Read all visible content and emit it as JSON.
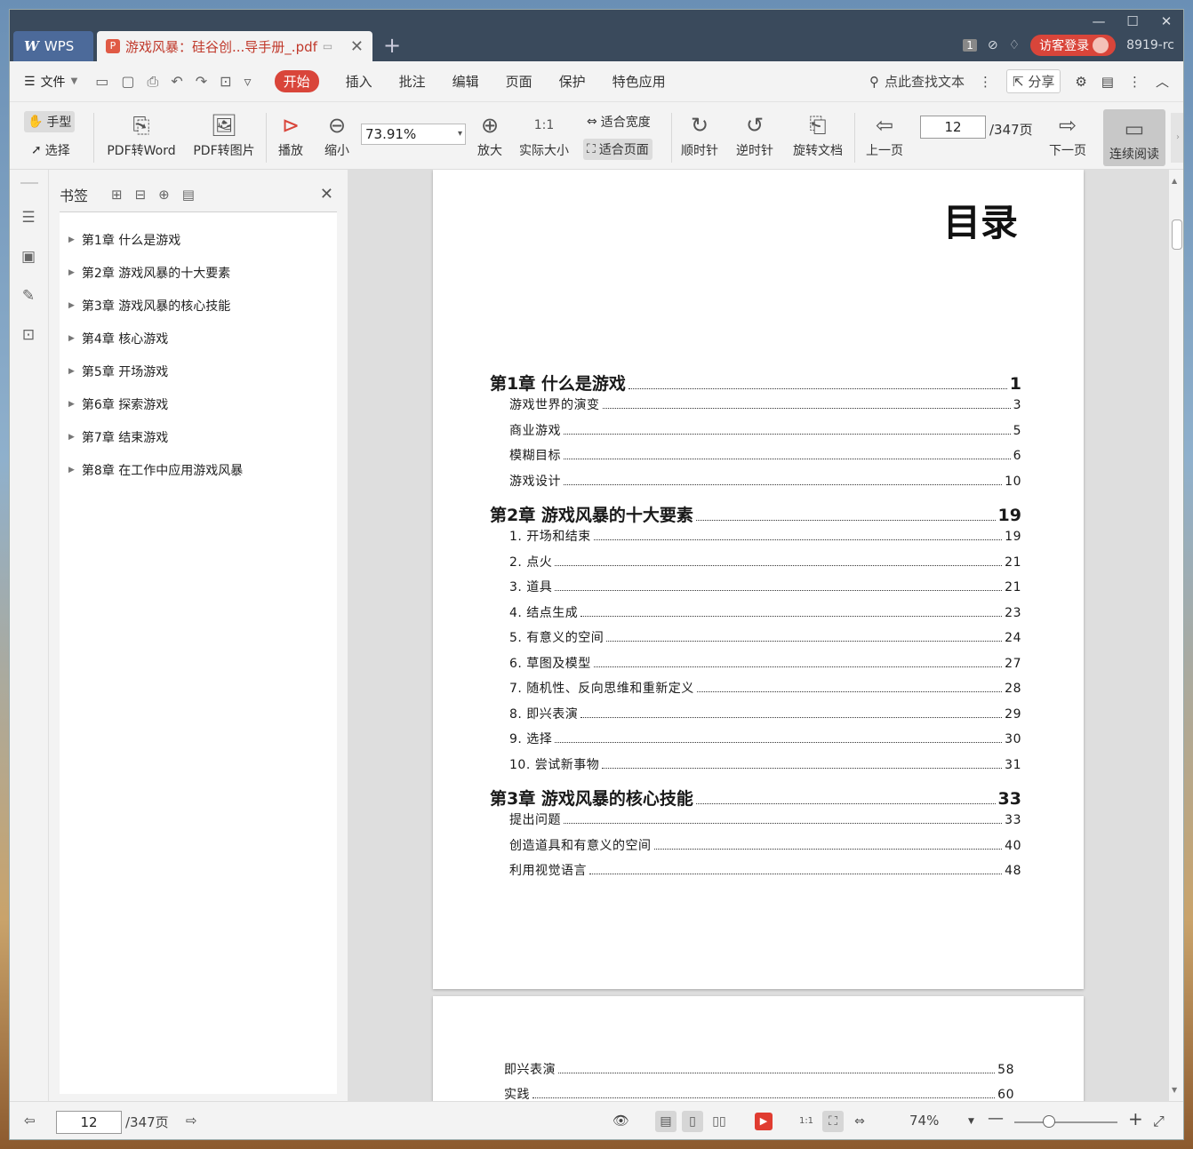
{
  "titlebar": {
    "app_tab": "WPS",
    "doc_tab": "游戏风暴：硅谷创...导手册_.pdf",
    "badge": "1",
    "login": "访客登录",
    "user": "8919-rc"
  },
  "menu": {
    "file": "文件",
    "tabs": [
      "开始",
      "插入",
      "批注",
      "编辑",
      "页面",
      "保护",
      "特色应用"
    ],
    "search": "点此查找文本",
    "share": "分享"
  },
  "toolbar": {
    "hand": "手型",
    "select": "选择",
    "pdf_to_word": "PDF转Word",
    "pdf_to_image": "PDF转图片",
    "play": "播放",
    "zoom_out": "缩小",
    "zoom_value": "73.91%",
    "zoom_in": "放大",
    "actual_size": "实际大小",
    "fit_width": "适合宽度",
    "fit_page": "适合页面",
    "clockwise": "顺时针",
    "counter_clockwise": "逆时针",
    "rotate_doc": "旋转文档",
    "prev_page": "上一页",
    "current_page": "12",
    "total_pages": "/347页",
    "next_page": "下一页",
    "continuous": "连续阅读"
  },
  "bookmarks": {
    "title": "书签",
    "items": [
      "第1章 什么是游戏",
      "第2章 游戏风暴的十大要素",
      "第3章 游戏风暴的核心技能",
      "第4章 核心游戏",
      "第5章 开场游戏",
      "第6章 探索游戏",
      "第7章 结束游戏",
      "第8章 在工作中应用游戏风暴"
    ]
  },
  "page1": {
    "title": "目录",
    "toc": [
      {
        "type": "ch",
        "label": "第1章  什么是游戏",
        "page": "1"
      },
      {
        "type": "sec",
        "label": "游戏世界的演变",
        "page": "3"
      },
      {
        "type": "sec",
        "label": "商业游戏",
        "page": "5"
      },
      {
        "type": "sec",
        "label": "模糊目标",
        "page": "6"
      },
      {
        "type": "sec",
        "label": "游戏设计",
        "page": "10"
      },
      {
        "type": "ch",
        "label": "第2章  游戏风暴的十大要素",
        "page": "19"
      },
      {
        "type": "sec",
        "label": "1. 开场和结束",
        "page": "19"
      },
      {
        "type": "sec",
        "label": "2. 点火",
        "page": "21"
      },
      {
        "type": "sec",
        "label": "3. 道具",
        "page": "21"
      },
      {
        "type": "sec",
        "label": "4. 结点生成",
        "page": "23"
      },
      {
        "type": "sec",
        "label": "5. 有意义的空间",
        "page": "24"
      },
      {
        "type": "sec",
        "label": "6. 草图及模型",
        "page": "27"
      },
      {
        "type": "sec",
        "label": "7. 随机性、反向思维和重新定义",
        "page": "28"
      },
      {
        "type": "sec",
        "label": "8. 即兴表演",
        "page": "29"
      },
      {
        "type": "sec",
        "label": "9. 选择",
        "page": "30"
      },
      {
        "type": "sec",
        "label": "10. 尝试新事物",
        "page": "31"
      },
      {
        "type": "ch",
        "label": "第3章  游戏风暴的核心技能",
        "page": "33"
      },
      {
        "type": "sec",
        "label": "提出问题",
        "page": "33"
      },
      {
        "type": "sec",
        "label": "创造道具和有意义的空间",
        "page": "40"
      },
      {
        "type": "sec",
        "label": "利用视觉语言",
        "page": "48"
      }
    ]
  },
  "page2": {
    "toc": [
      {
        "label": "即兴表演",
        "page": "58"
      },
      {
        "label": "实践",
        "page": "60"
      }
    ]
  },
  "status": {
    "current_page": "12",
    "total_pages": "/347页",
    "zoom": "74%"
  }
}
